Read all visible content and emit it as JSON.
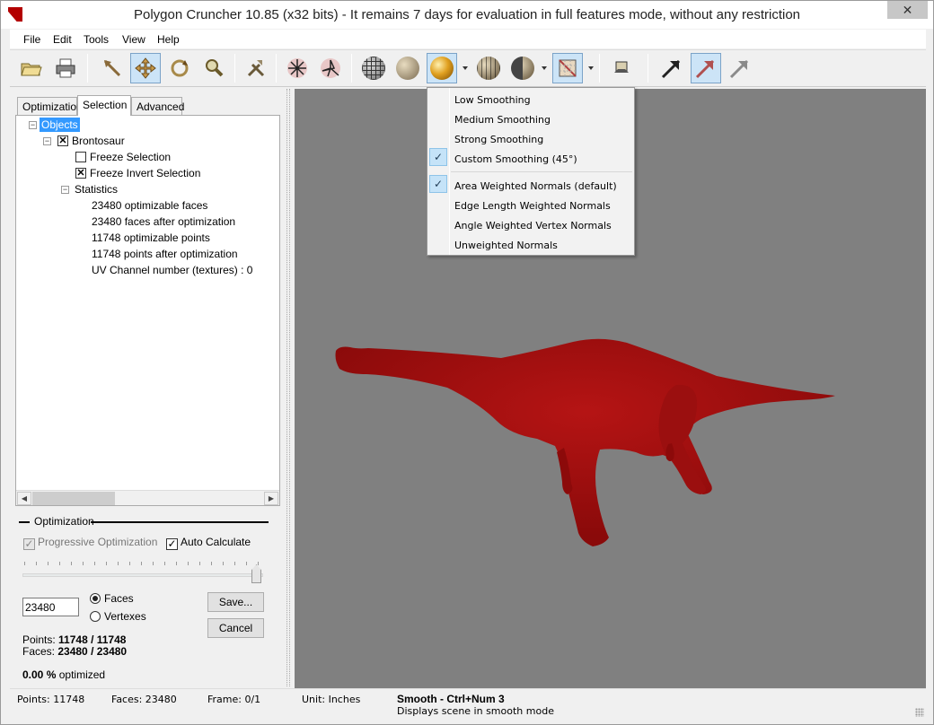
{
  "window": {
    "title": "Polygon Cruncher 10.85 (x32 bits) - It remains 7 days for evaluation in full features mode, without any restriction",
    "close_glyph": "✕"
  },
  "menu": [
    "File",
    "Edit",
    "Tools",
    "View",
    "Help"
  ],
  "toolbar": {
    "buttons": [
      "open-icon",
      "print-icon",
      "select-arrow-icon",
      "move-icon",
      "rotate-icon",
      "zoom-icon",
      "tools-icon",
      "vertex-icon",
      "edge-icon",
      "wireframe-sphere-icon",
      "flat-sphere-icon",
      "smooth-sphere-icon",
      "faceted-sphere-icon",
      "half-sphere-icon",
      "texture-icon",
      "camera-icon",
      "normal-arrow-icon",
      "normal-arrow-selected-icon",
      "normal-arrow-gray-icon"
    ]
  },
  "tabs": [
    "Optimization",
    "Selection",
    "Advanced"
  ],
  "tree": {
    "root": "Objects",
    "object": "Brontosaur",
    "freeze": "Freeze Selection",
    "freeze_invert": "Freeze Invert Selection",
    "statistics": "Statistics",
    "stats": [
      "23480 optimizable faces",
      "23480 faces after optimization",
      "11748 optimizable points",
      "11748 points after optimization",
      "UV Channel number (textures) : 0"
    ]
  },
  "optimization": {
    "group_label": "Optimization",
    "progressive": "Progressive Optimization",
    "auto_calc": "Auto Calculate",
    "slider_level": 1.0,
    "value": "23480",
    "faces_label": "Faces",
    "vertexes_label": "Vertexes",
    "save_label": "Save...",
    "cancel_label": "Cancel",
    "points_label": "Points:",
    "points_value": "11748 / 11748",
    "faces_count_label": "Faces:",
    "faces_value": "23480 / 23480",
    "percent": "0.00",
    "percent_sign": "%",
    "percent_label": "optimized"
  },
  "dropdown": {
    "items": [
      "Low Smoothing",
      "Medium Smoothing",
      "Strong Smoothing",
      "Custom Smoothing (45°)",
      "Area Weighted Normals (default)",
      "Edge Length Weighted Normals",
      "Angle Weighted Vertex Normals",
      "Unweighted Normals"
    ],
    "check": "✓"
  },
  "status": {
    "points": "Points: 11748",
    "faces": "Faces: 23480",
    "frame": "Frame: 0/1",
    "unit": "Unit: Inches",
    "cmd": "Smooth - Ctrl+Num 3",
    "desc": "Displays scene in smooth mode"
  },
  "colors": {
    "model": "#a50f0f",
    "viewport": "#808080",
    "highlight": "#3399ff"
  }
}
